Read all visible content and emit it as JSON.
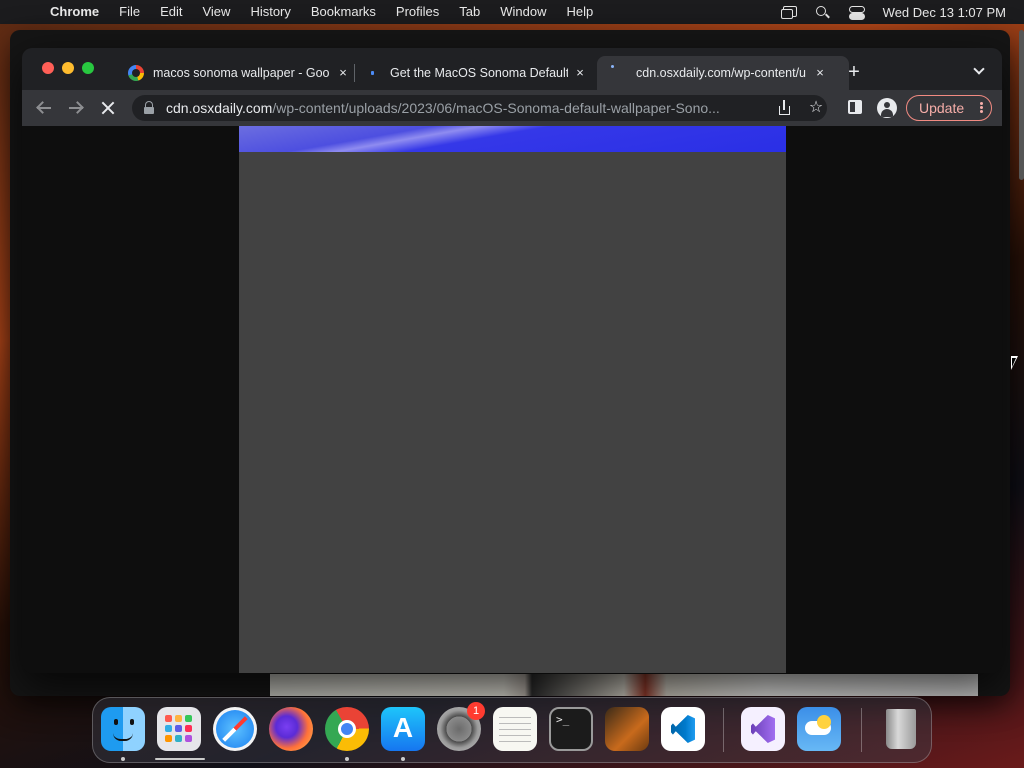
{
  "menubar": {
    "app_name": "Chrome",
    "menus": [
      "File",
      "Edit",
      "View",
      "History",
      "Bookmarks",
      "Profiles",
      "Tab",
      "Window",
      "Help"
    ],
    "clock": "Wed Dec 13  1:07 PM"
  },
  "browser": {
    "tabs": [
      {
        "title": "macos sonoma wallpaper - Goo",
        "favicon": "google-icon",
        "active": false
      },
      {
        "title": "Get the MacOS Sonoma Default",
        "favicon": "site-icon",
        "active": false
      },
      {
        "title": "cdn.osxdaily.com/wp-content/u",
        "favicon": "loading-icon",
        "active": true
      }
    ],
    "new_tab_symbol": "+",
    "close_symbol": "×",
    "address_bar": {
      "domain": "cdn.osxdaily.com",
      "path": "/wp-content/uploads/2023/06/macOS-Sonoma-default-wallpaper-Sono..."
    },
    "star_symbol": "☆",
    "update_label": "Update"
  },
  "dock": {
    "apps": [
      "Finder",
      "Launchpad",
      "Safari",
      "Firefox",
      "Google Chrome",
      "App Store",
      "System Settings",
      "TextEdit",
      "Terminal",
      "GarageBand",
      "Visual Studio Code",
      "Visual Studio",
      "Weather",
      "Trash"
    ],
    "settings_badge": "1"
  },
  "colors": {
    "update_accent": "#f28b82",
    "image_header_blue": "#2a2fe6"
  }
}
